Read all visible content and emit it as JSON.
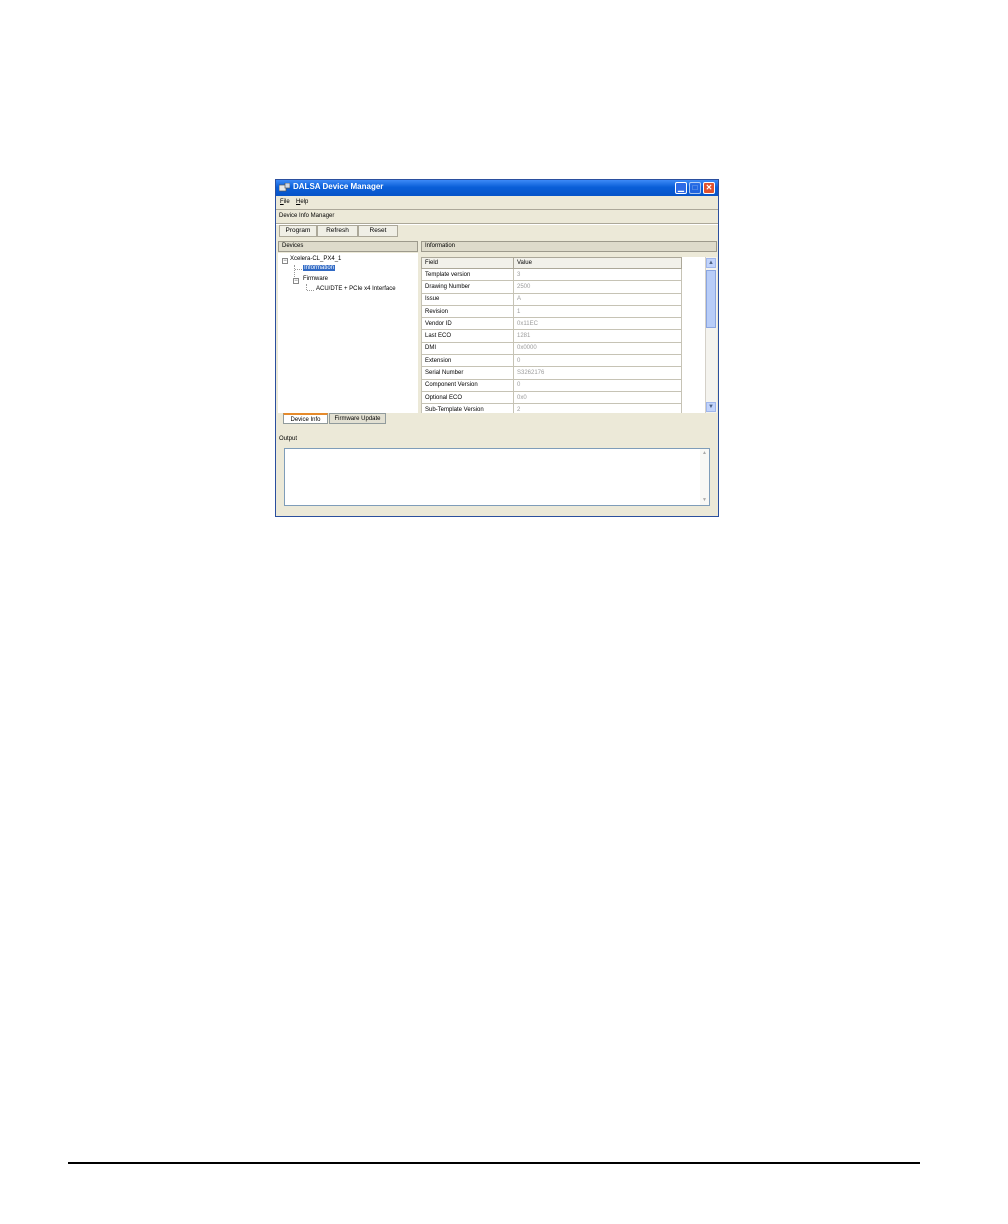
{
  "window": {
    "title": "DALSA Device Manager"
  },
  "menu": [
    {
      "label": "File"
    },
    {
      "label": "Help"
    }
  ],
  "panel_title": "Device Info Manager",
  "toolbar": {
    "program": "Program",
    "refresh": "Refresh",
    "reset": "Reset"
  },
  "devices": {
    "header": "Devices",
    "root": "Xcelera-CL_PX4_1",
    "child_information": "Information",
    "child_firmware": "Firmware",
    "firmware_item": "ACU/DTE + PCIe x4 Interface"
  },
  "information": {
    "header": "Information",
    "columns": {
      "field": "Field",
      "value": "Value"
    },
    "rows": [
      {
        "field": "Template version",
        "value": "3"
      },
      {
        "field": "Drawing Number",
        "value": "2500"
      },
      {
        "field": "Issue",
        "value": "A"
      },
      {
        "field": "Revision",
        "value": "1"
      },
      {
        "field": "Vendor ID",
        "value": "0x11EC"
      },
      {
        "field": "Last ECO",
        "value": "1281"
      },
      {
        "field": "DMI",
        "value": "0x0000"
      },
      {
        "field": "Extension",
        "value": "0"
      },
      {
        "field": "Serial Number",
        "value": "S3262176"
      },
      {
        "field": "Component Version",
        "value": "0"
      },
      {
        "field": "Optional ECO",
        "value": "0x0"
      },
      {
        "field": "Sub-Template Version",
        "value": "2"
      }
    ]
  },
  "tabs": {
    "device_info": "Device Info",
    "firmware_update": "Firmware Update"
  },
  "output": {
    "label": "Output"
  },
  "colors": {
    "titlebar": "#0a5fd8",
    "selection": "#316ac5",
    "window_bg": "#ece9d8"
  }
}
